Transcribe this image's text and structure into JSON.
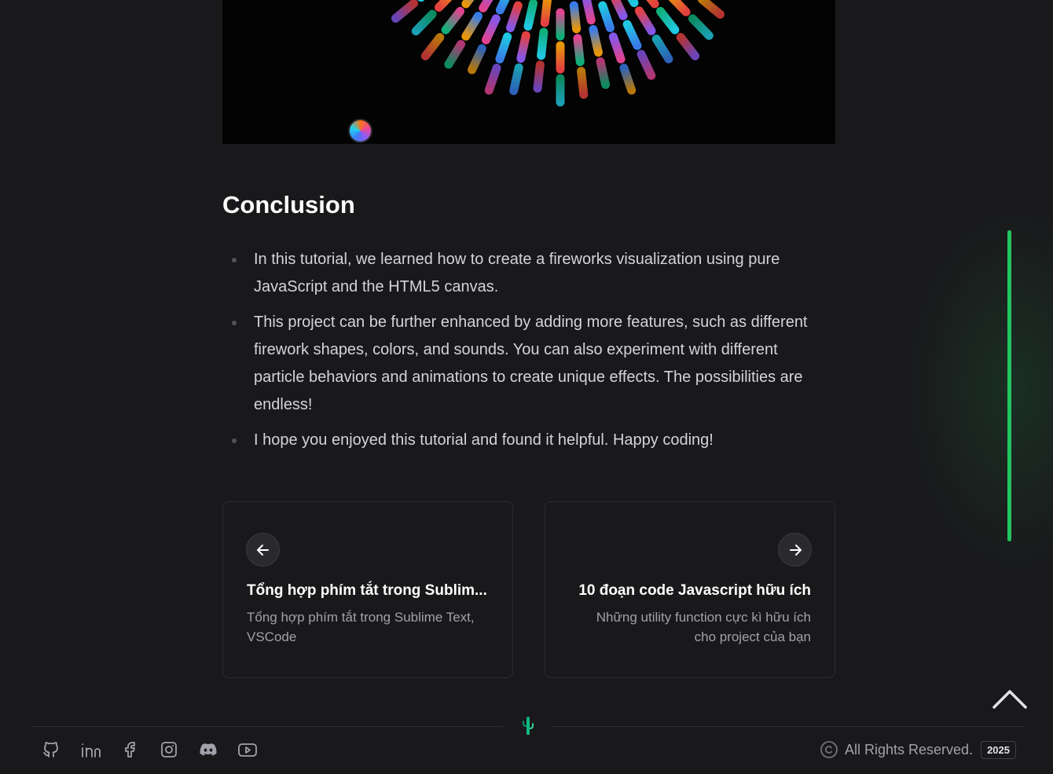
{
  "hero": {
    "firework_colors": [
      "#3b82f6",
      "#ec4899",
      "#f59e0b",
      "#10b981",
      "#ef4444",
      "#22d3ee",
      "#8b5cf6"
    ]
  },
  "conclusion": {
    "title": "Conclusion",
    "bullets": [
      "In this tutorial, we learned how to create a fireworks visualization using pure JavaScript and the HTML5 canvas.",
      "This project can be further enhanced by adding more features, such as different firework shapes, colors, and sounds. You can also experiment with different particle behaviors and animations to create unique effects. The possibilities are endless!",
      "I hope you enjoyed this tutorial and found it helpful. Happy coding!"
    ]
  },
  "nav": {
    "prev": {
      "title": "Tổng hợp phím tắt trong Sublim...",
      "description": "Tổng hợp phím tắt trong Sublime Text, VSCode",
      "icon": "arrow-left-icon"
    },
    "next": {
      "title": "10 đoạn code Javascript hữu ích",
      "description": "Những utility function cực kì hữu ích cho project của bạn",
      "icon": "arrow-right-icon"
    }
  },
  "reading_progress": {
    "fraction": 1.0,
    "color": "#22c55e"
  },
  "footer": {
    "socials": [
      "github-icon",
      "linkedin-icon",
      "facebook-icon",
      "instagram-icon",
      "discord-icon",
      "youtube-icon"
    ],
    "copyright_text": "All Rights Reserved.",
    "year": "2025",
    "accent": "#22c55e"
  }
}
